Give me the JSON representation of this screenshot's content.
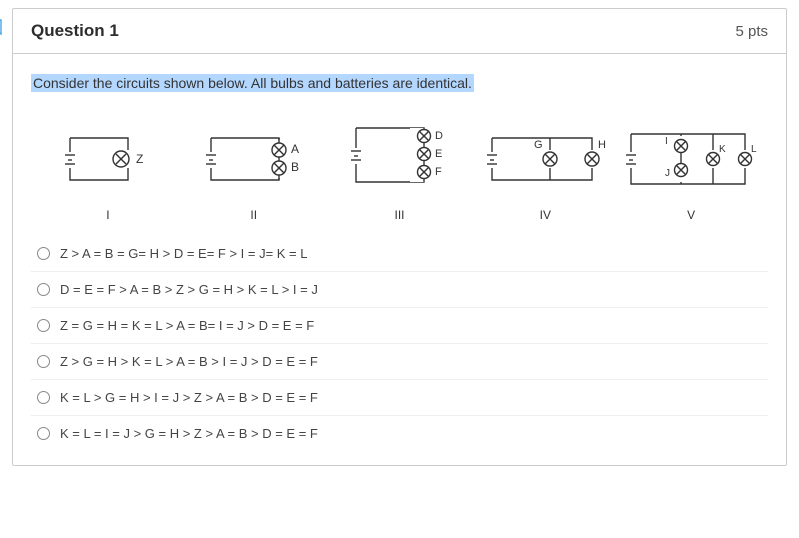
{
  "header": {
    "title": "Question 1",
    "points": "5 pts"
  },
  "prompt": "Consider the circuits shown below. All bulbs and batteries are identical.",
  "circuits": {
    "labels": {
      "c1_bulb": "Z",
      "c2_bulb_top": "A",
      "c2_bulb_bot": "B",
      "c3_bulb_top": "D",
      "c3_bulb_mid": "E",
      "c3_bulb_bot": "F",
      "c4_bulb_left": "G",
      "c4_bulb_right": "H",
      "c5_bulb_i": "I",
      "c5_bulb_j": "J",
      "c5_bulb_k": "K",
      "c5_bulb_l": "L"
    },
    "romans": [
      "I",
      "II",
      "III",
      "IV",
      "V"
    ]
  },
  "options": [
    "Z > A = B = G= H > D = E= F > I = J= K = L",
    "D = E = F > A = B > Z > G = H > K = L > I = J",
    "Z = G = H = K = L > A = B= I = J > D = E = F",
    "Z > G = H > K = L > A = B > I = J > D = E = F",
    "K = L > G = H > I = J > Z > A = B > D = E = F",
    "K = L = I = J > G = H > Z > A = B > D = E = F"
  ]
}
